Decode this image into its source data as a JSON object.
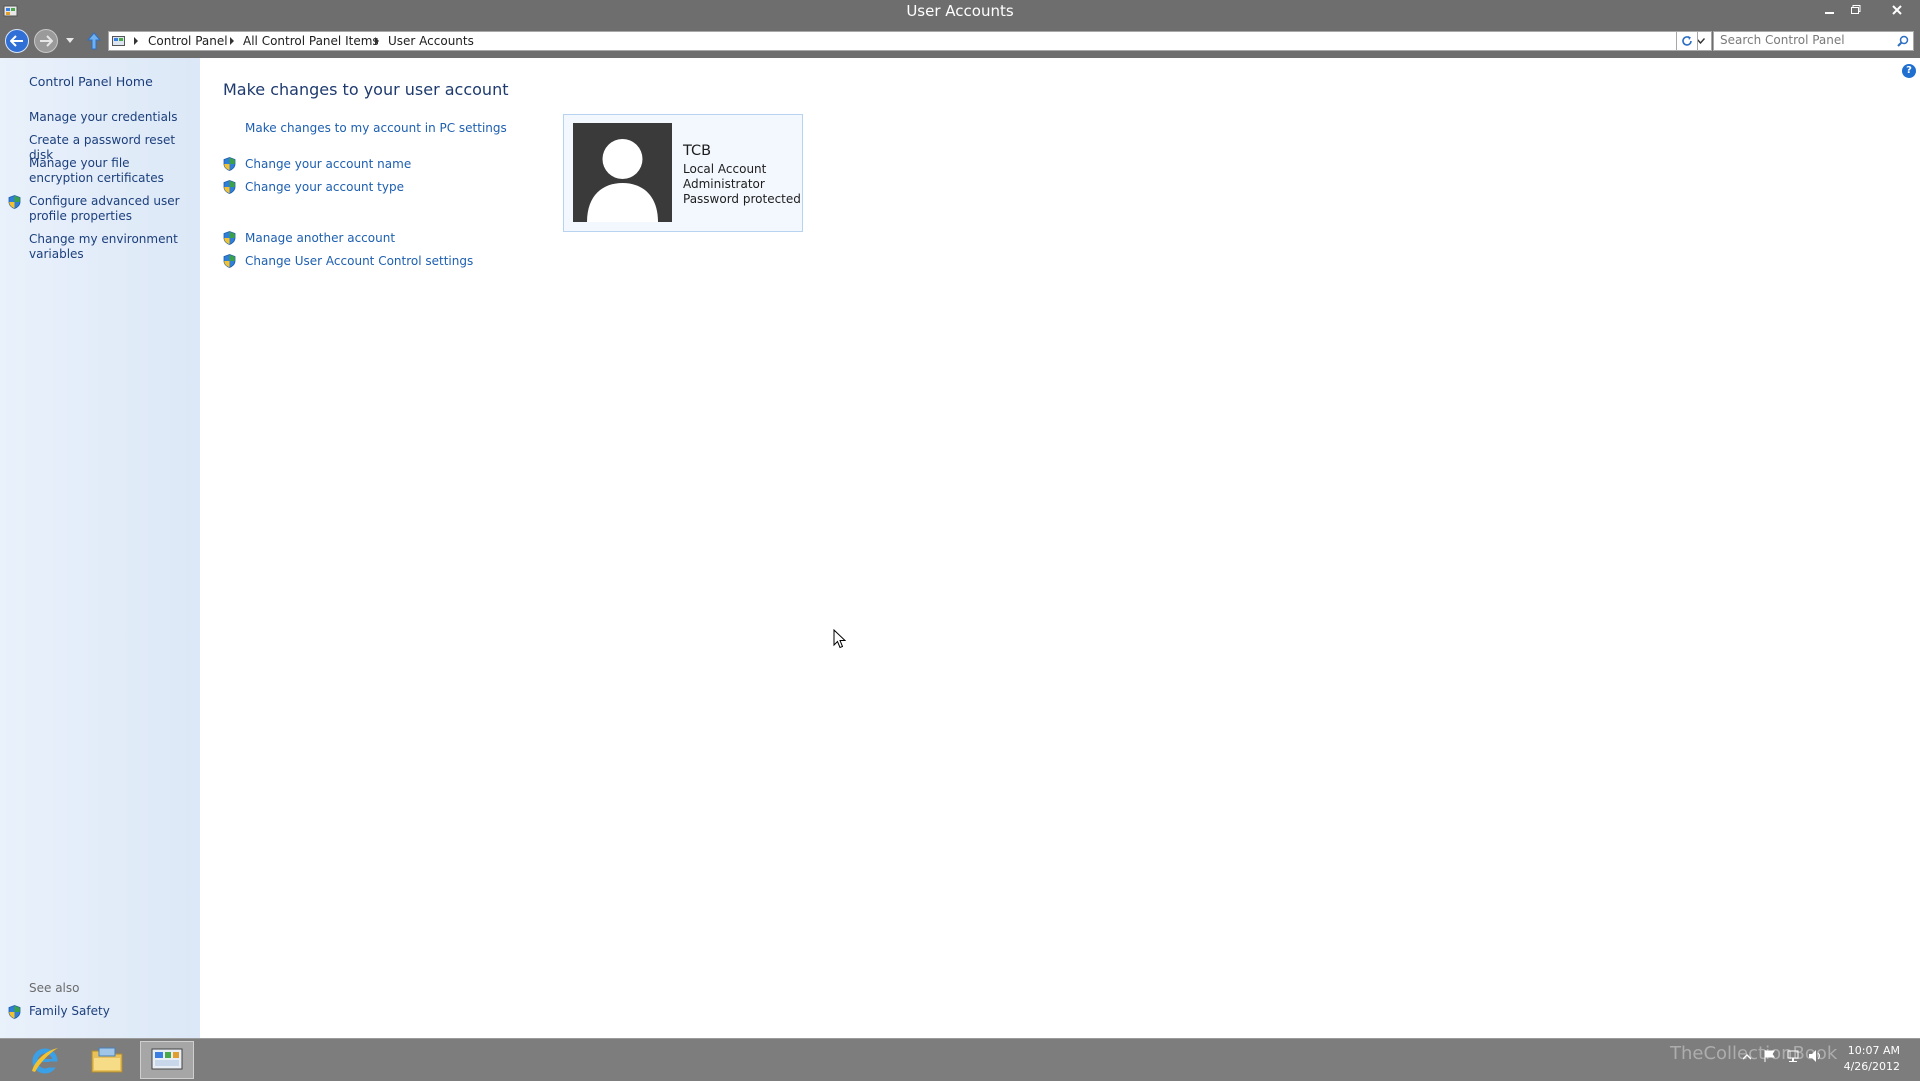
{
  "window": {
    "title": "User Accounts"
  },
  "address": {
    "crumbs": [
      "Control Panel",
      "All Control Panel Items",
      "User Accounts"
    ],
    "search_placeholder": "Search Control Panel"
  },
  "sidebar": {
    "home": "Control Panel Home",
    "items": [
      {
        "label": "Manage your credentials",
        "shield": false
      },
      {
        "label": "Create a password reset disk",
        "shield": false
      },
      {
        "label": "Manage your file encryption certificates",
        "shield": false
      },
      {
        "label": "Configure advanced user profile properties",
        "shield": true
      },
      {
        "label": "Change my environment variables",
        "shield": false
      }
    ],
    "see_also_heading": "See also",
    "see_also": [
      {
        "label": "Family Safety",
        "shield": true
      }
    ]
  },
  "main": {
    "title": "Make changes to your user account",
    "links": [
      {
        "label": "Make changes to my account in PC settings",
        "shield": false
      },
      {
        "label": "Change your account name",
        "shield": true
      },
      {
        "label": "Change your account type",
        "shield": true
      },
      {
        "label": "Manage another account",
        "shield": true
      },
      {
        "label": "Change User Account Control settings",
        "shield": true
      }
    ],
    "account": {
      "name": "TCB",
      "type": "Local Account",
      "role": "Administrator",
      "status": "Password protected"
    }
  },
  "taskbar": {
    "items": [
      "internet-explorer",
      "file-explorer",
      "control-panel"
    ],
    "time": "10:07 AM",
    "date": "4/26/2012",
    "watermark": "TheCollectionBook"
  },
  "colors": {
    "link": "#1d5fb0",
    "title_text": "#1e3a6e",
    "chrome": "#6e6e6e",
    "sidebar_bg": "#e4eefa"
  }
}
